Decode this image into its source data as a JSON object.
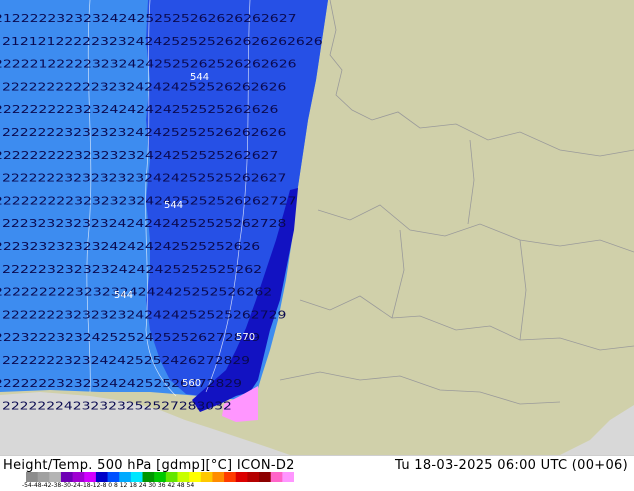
{
  "footer": {
    "title": "Height/Temp. 500 hPa [gdmp][°C] ICON-D2",
    "valid_time": "Tu 18-03-2025 06:00 UTC (00+06)"
  },
  "colorbar": {
    "ticks": "-54-48-42-38-30-24-18-12-8 0 8 12 18 24 30 36 42 48 54",
    "colors": [
      "#8c8c8c",
      "#a0a0a0",
      "#b4b4b4",
      "#6e00b4",
      "#a000d2",
      "#d200ff",
      "#0000c8",
      "#0050ff",
      "#00aaff",
      "#00e6ff",
      "#009600",
      "#00c800",
      "#64e600",
      "#c8ff00",
      "#ffff00",
      "#ffc800",
      "#ff8c00",
      "#ff3c00",
      "#dc0000",
      "#b40000",
      "#8c0000",
      "#ff64c8",
      "#ff96ff"
    ]
  },
  "map": {
    "colors": {
      "light_blue": "#3d8cf0",
      "mid_blue": "#2650e6",
      "dark_blue": "#1212c2",
      "pink": "#ff96ff",
      "land": "#d0d0aa",
      "sea": "#d8d8d8"
    },
    "contour_labels": [
      "544",
      "544",
      "544",
      "570",
      "560"
    ],
    "rows": [
      "21 22 22 23 23 23 24 24 25 25 25 26 26 26 26 26 27",
      "21 21 21 22 22 23 23 24 24 25 25 25 26 26 26 26 26 26",
      "22 22 21 22 22 23 23 24 24 25 25 26 25 26 26 26 26",
      "22 22 22 22 22 23 23 24 24 24 25 25 26 26 26 26",
      "22 22 22 22 23 23 24 24 24 24 25 25 25 26 26 26",
      "22 22 22 23 23 23 23 24 24 25 25 25 26 26 26 26",
      "22 22 22 22 23 23 23 23 24 24 25 25 25 26 26 27",
      "22 22 22 23 23 23 23 23 24 24 25 25 25 26 26 27",
      "22 22 22 22 23 23 23 23 24 24 25 25 25 26 26 27 27",
      "22 23 23 23 23 23 24 24 24 24 25 25 25 26 27 28",
      "22 23 23 23 23 23 24 24 24 24 25 25 25 26 26",
      "22 22 23 23 23 23 24 24 24 25 25 25 25 26 2",
      "22 22 22 22 23 23 23 24 24 24 25 25 25 26 26 2",
      "22 22 22 23 23 23 23 24 24 24 25 25 25 26 27 29",
      "22 23 22 23 23 24 25 25 24 25 25 26 27 28 29",
      "22 22 22 23 23 24 24 25 25 24 26 27 28 29",
      "22 22 22 23 23 23 24 24 25 25 26 27 28 29",
      "22 22 22 24 23 23 23 25 25 27 28 30 32"
    ]
  }
}
